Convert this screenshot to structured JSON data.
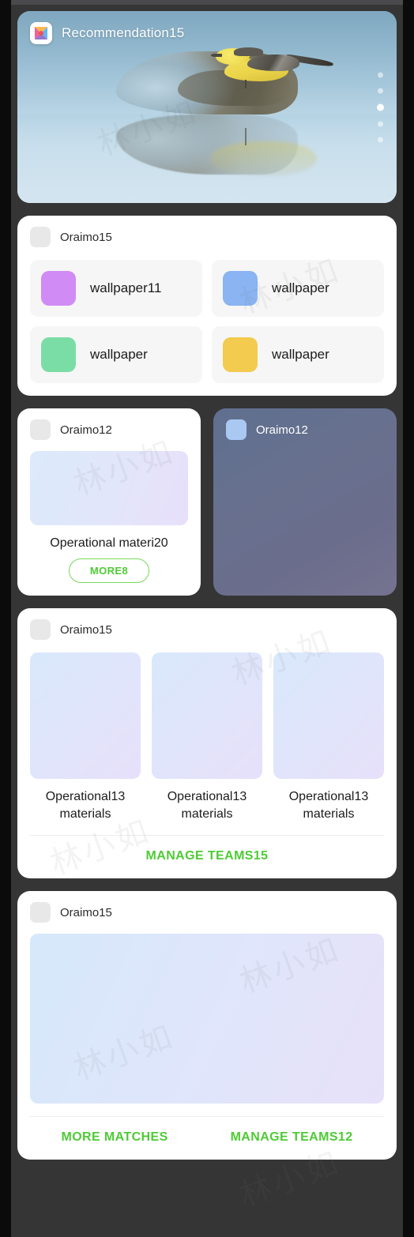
{
  "screen": {
    "background": "#353535",
    "accent_green": "#4ecb35"
  },
  "hero": {
    "app_icon": "butterfly-x-icon",
    "title": "Recommendation15",
    "image_description": "yellow wagtail bird perched on a rock reflected in water",
    "pager": {
      "total": 5,
      "active_index": 2
    }
  },
  "wallpaper_card": {
    "header_label": "Oraimo15",
    "items": [
      {
        "label": "wallpaper11",
        "color": "#d18bf5"
      },
      {
        "label": "wallpaper",
        "color": "#8ab4f2"
      },
      {
        "label": "wallpaper",
        "color": "#7bdda6"
      },
      {
        "label": "wallpaper",
        "color": "#f2cb4f"
      }
    ]
  },
  "operational_card": {
    "header_label": "Oraimo12",
    "caption": "Operational materi20",
    "more_button": "MORE8"
  },
  "dark_card": {
    "header_label": "Oraimo12",
    "background": "#6b7191"
  },
  "teams_card": {
    "header_label": "Oraimo15",
    "items": [
      {
        "caption": "Operational13 materials"
      },
      {
        "caption": "Operational13 materials"
      },
      {
        "caption": "Operational13 materials"
      }
    ],
    "action": "MANAGE TEAMS15"
  },
  "matches_card": {
    "header_label": "Oraimo15",
    "action_left": "MORE MATCHES",
    "action_right": "MANAGE TEAMS12"
  },
  "watermark": {
    "text": "林小如"
  }
}
